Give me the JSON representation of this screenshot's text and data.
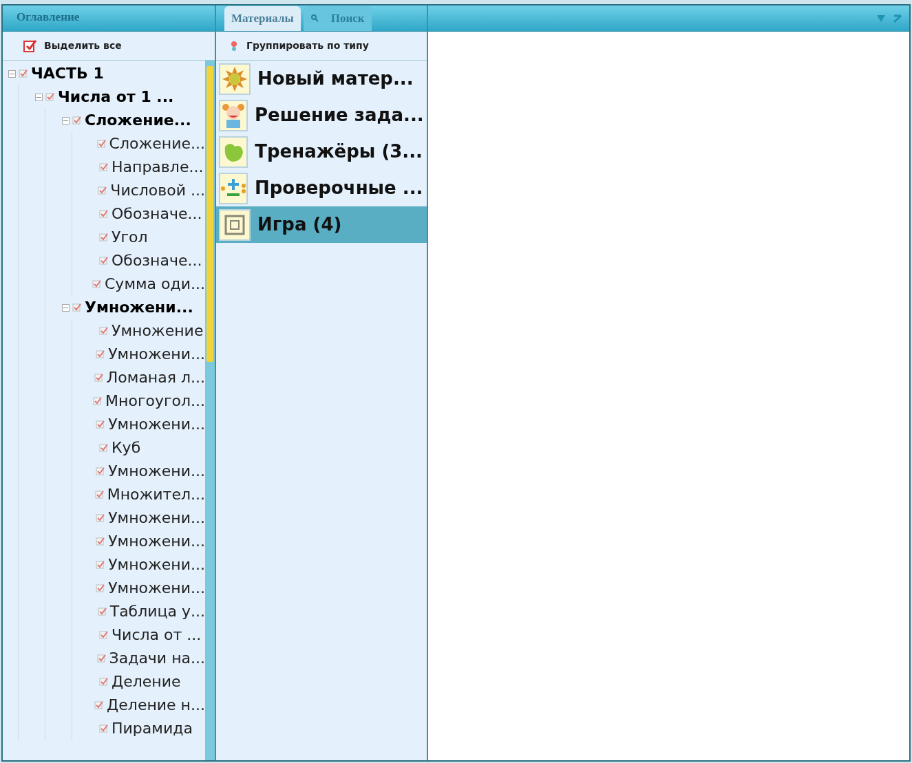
{
  "contents_panel": {
    "title": "Оглавление",
    "select_all_button": "Выделить все",
    "tree": [
      {
        "label": "ЧАСТЬ 1",
        "expanded": true,
        "children": [
          {
            "label": "Числа от 1 ...",
            "expanded": true,
            "children": [
              {
                "label": "Сложение...",
                "expanded": true,
                "children": [
                  {
                    "label": "Сложение..."
                  },
                  {
                    "label": "Направле..."
                  },
                  {
                    "label": "Числовой ..."
                  },
                  {
                    "label": "Обозначе..."
                  },
                  {
                    "label": "Угол"
                  },
                  {
                    "label": "Обозначе..."
                  },
                  {
                    "label": "Сумма оди..."
                  }
                ]
              },
              {
                "label": "Умножени...",
                "expanded": true,
                "children": [
                  {
                    "label": "Умножение"
                  },
                  {
                    "label": "Умножени..."
                  },
                  {
                    "label": "Ломаная л..."
                  },
                  {
                    "label": "Многоугол..."
                  },
                  {
                    "label": "Умножени..."
                  },
                  {
                    "label": "Куб"
                  },
                  {
                    "label": "Умножени..."
                  },
                  {
                    "label": "Множител..."
                  },
                  {
                    "label": "Умножени..."
                  },
                  {
                    "label": "Умножени..."
                  },
                  {
                    "label": "Умножени..."
                  },
                  {
                    "label": "Умножени..."
                  },
                  {
                    "label": "Таблица у..."
                  },
                  {
                    "label": "Числа от ..."
                  },
                  {
                    "label": "Задачи на..."
                  },
                  {
                    "label": "Деление"
                  },
                  {
                    "label": "Деление н..."
                  },
                  {
                    "label": "Пирамида"
                  }
                ]
              }
            ]
          }
        ]
      }
    ]
  },
  "materials_panel": {
    "tabs": [
      {
        "label": "Материалы",
        "selected": true,
        "kind": "plain"
      },
      {
        "label": "Поиск",
        "selected": false,
        "kind": "search"
      }
    ],
    "group_button": "Группировать по типу",
    "items": [
      {
        "label": "Новый матер...",
        "kind": "sun",
        "selected": false
      },
      {
        "label": "Решение зада...",
        "kind": "cartoon",
        "selected": false
      },
      {
        "label": "Тренажёры (3...",
        "kind": "leaf",
        "selected": false
      },
      {
        "label": "Проверочные ...",
        "kind": "plusminus",
        "selected": false
      },
      {
        "label": "Игра (4)",
        "kind": "game",
        "selected": true
      }
    ]
  }
}
